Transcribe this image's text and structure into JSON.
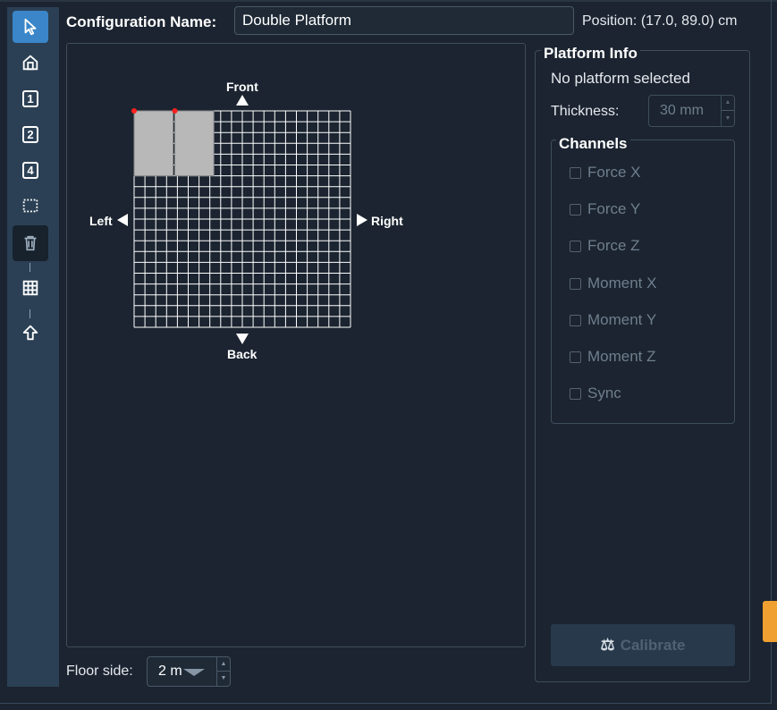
{
  "header": {
    "config_label": "Configuration Name:",
    "config_value": "Double Platform",
    "position": "Position: (17.0, 89.0) cm"
  },
  "toolbar": {
    "items": [
      {
        "icon": "cursor-icon"
      },
      {
        "icon": "home-platform-icon"
      },
      {
        "icon": "one-platform-icon",
        "text": "1"
      },
      {
        "icon": "two-platform-icon",
        "text": "2"
      },
      {
        "icon": "four-platform-icon",
        "text": "4"
      },
      {
        "icon": "selection-rect-icon"
      },
      {
        "icon": "trash-icon"
      },
      {
        "icon": "grid-icon"
      },
      {
        "icon": "arrow-up-icon"
      }
    ]
  },
  "canvas": {
    "front": "Front",
    "back": "Back",
    "left": "Left",
    "right": "Right",
    "grid_cells": 20,
    "colors": {
      "grid_line": "#ffffff",
      "platform": "#b8b8b8",
      "marker": "#ff2020"
    }
  },
  "floor": {
    "label": "Floor side:",
    "value": "2 m"
  },
  "platform_info": {
    "title": "Platform Info",
    "status": "No platform selected",
    "thickness_label": "Thickness:",
    "thickness_value": "30 mm",
    "channels_title": "Channels",
    "channels": [
      "Force X",
      "Force Y",
      "Force Z",
      "Moment X",
      "Moment Y",
      "Moment Z",
      "Sync"
    ],
    "calibrate_label": "Calibrate"
  }
}
